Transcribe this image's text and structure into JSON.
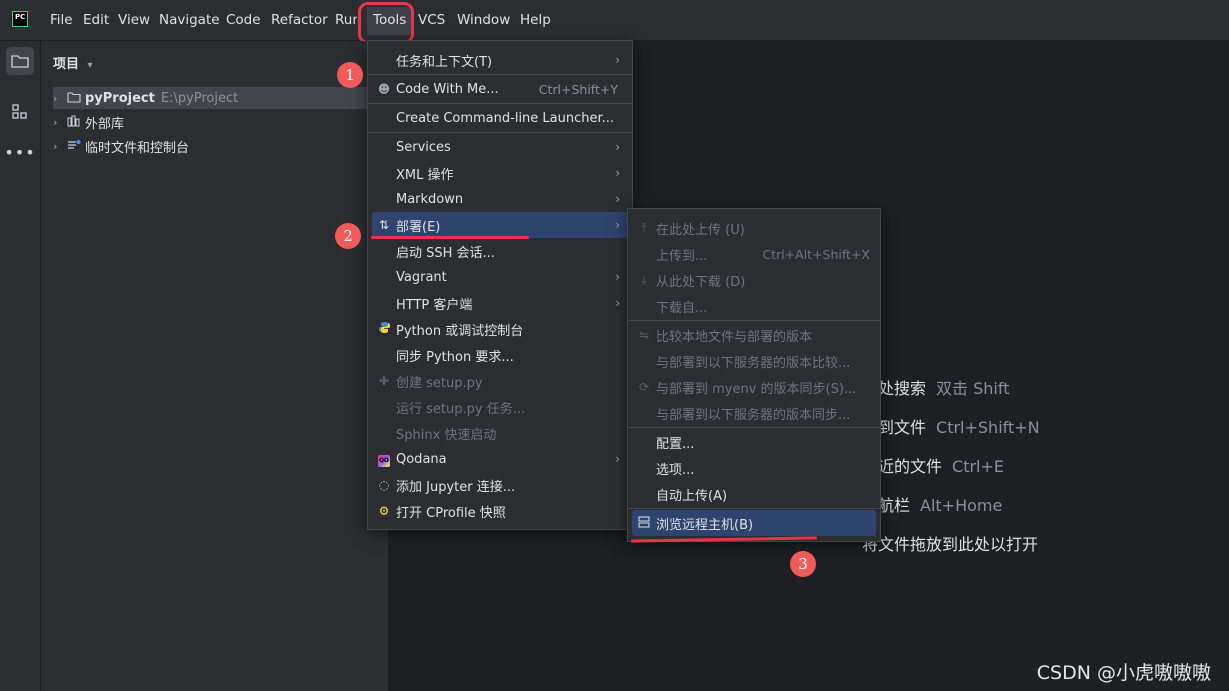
{
  "logo": {
    "text": "PC"
  },
  "menubar": [
    "File",
    "Edit",
    "View",
    "Navigate",
    "Code",
    "Refactor",
    "Run",
    "Tools",
    "VCS",
    "Window",
    "Help"
  ],
  "project_panel": {
    "title": "项目",
    "tree": [
      {
        "label": "pyProject",
        "path": "E:\\pyProject"
      },
      {
        "label": "外部库"
      },
      {
        "label": "临时文件和控制台"
      }
    ]
  },
  "welcome_hints": [
    {
      "label": "随处搜索",
      "key": "双击 Shift"
    },
    {
      "label": "转到文件",
      "key": "Ctrl+Shift+N"
    },
    {
      "label": "最近的文件",
      "key": "Ctrl+E"
    },
    {
      "label": "导航栏",
      "key": "Alt+Home"
    },
    {
      "label": "将文件拖放到此处以打开",
      "key": ""
    }
  ],
  "tools_menu": [
    {
      "label": "任务和上下文(T)",
      "submenu": true
    },
    {
      "label": "Code With Me...",
      "shortcut": "Ctrl+Shift+Y",
      "icon": "user-plus-icon"
    },
    {
      "label": "Create Command-line Launcher..."
    },
    {
      "label": "Services",
      "submenu": true
    },
    {
      "label": "XML 操作",
      "submenu": true
    },
    {
      "label": "Markdown",
      "submenu": true
    },
    {
      "label": "部署(E)",
      "submenu": true,
      "icon": "deploy-arrows-icon"
    },
    {
      "label": "启动 SSH 会话..."
    },
    {
      "label": "Vagrant",
      "submenu": true
    },
    {
      "label": "HTTP 客户端",
      "submenu": true
    },
    {
      "label": "Python 或调试控制台",
      "icon": "python-icon"
    },
    {
      "label": "同步 Python 要求..."
    },
    {
      "label": "创建 setup.py",
      "disabled": true,
      "icon": "python-gray-icon"
    },
    {
      "label": "运行 setup.py 任务...",
      "disabled": true
    },
    {
      "label": "Sphinx 快速启动",
      "disabled": true
    },
    {
      "label": "Qodana",
      "submenu": true,
      "icon": "qodana-icon"
    },
    {
      "label": "添加 Jupyter 连接...",
      "icon": "jupyter-icon"
    },
    {
      "label": "打开 CProfile 快照",
      "icon": "profile-icon"
    }
  ],
  "deploy_menu": [
    {
      "label": "在此处上传 (U)",
      "disabled": true,
      "icon": "upload-icon"
    },
    {
      "label": "上传到...",
      "shortcut": "Ctrl+Alt+Shift+X",
      "disabled": true
    },
    {
      "label": "从此处下载 (D)",
      "disabled": true,
      "icon": "download-icon"
    },
    {
      "label": "下载自...",
      "disabled": true
    },
    {
      "label": "比较本地文件与部署的版本",
      "disabled": true,
      "icon": "compare-icon"
    },
    {
      "label": "与部署到以下服务器的版本比较...",
      "disabled": true
    },
    {
      "label": "与部署到 myenv 的版本同步(S)...",
      "disabled": true,
      "icon": "sync-icon"
    },
    {
      "label": "与部署到以下服务器的版本同步...",
      "disabled": true
    },
    {
      "label": "配置..."
    },
    {
      "label": "选项..."
    },
    {
      "label": "自动上传(A)"
    },
    {
      "label": "浏览远程主机(B)",
      "icon": "server-icon"
    }
  ],
  "annotations": [
    "1",
    "2",
    "3"
  ],
  "watermark": "CSDN @小虎嗷嗷嗷",
  "colors": {
    "highlight": "#2e436e",
    "annotation": "#f05a5a",
    "background": "#1e1f22",
    "panel": "#2b2d30"
  }
}
